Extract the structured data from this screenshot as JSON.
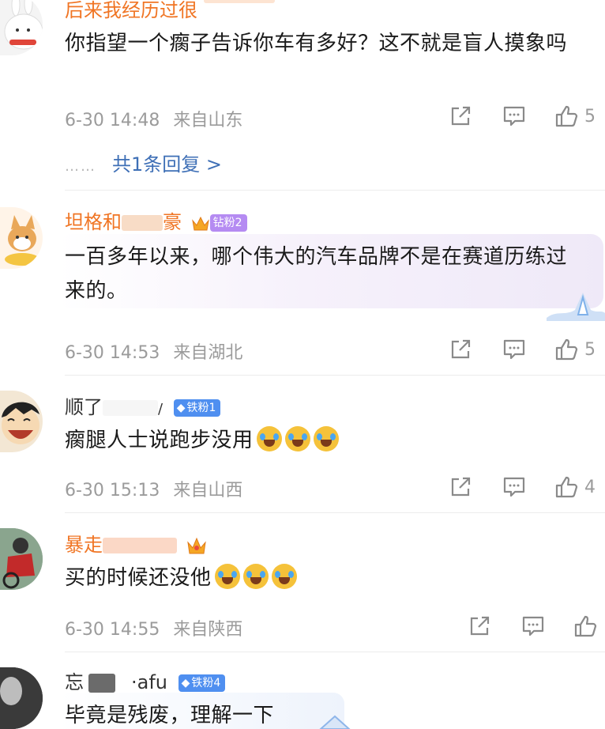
{
  "comments": [
    {
      "name": "后来我经历过很",
      "text": "你指望一个瘸子告诉你车有多好？这不就是盲人摸象吗",
      "date": "6-30 14:48",
      "location": "来自山东",
      "likes": "5",
      "replies": {
        "dots": "……",
        "label": "共1条回复 >"
      }
    },
    {
      "name": "坦格和",
      "name_suffix": "豪",
      "badge": "钻粉2",
      "text": "一百多年以来，哪个伟大的汽车品牌不是在赛道历练过来的。",
      "date": "6-30 14:53",
      "location": "来自湖北",
      "likes": "5"
    },
    {
      "name": "顺了",
      "name_suffix": "/",
      "badge": "铁粉1",
      "text": "瘸腿人士说跑步没用",
      "date": "6-30 15:13",
      "location": "来自山西",
      "likes": "4"
    },
    {
      "name": "暴走",
      "text": "买的时候还没他",
      "date": "6-30 14:55",
      "location": "来自陕西",
      "likes": ""
    },
    {
      "name": "忘",
      "name_suffix": "·afu",
      "badge": "铁粉4",
      "text": "毕竟是残废，理解一下"
    }
  ],
  "icons": {
    "share": "share-icon",
    "comment": "comment-icon",
    "like": "thumbs-up-icon",
    "emoji": "laugh-cry-emoji"
  },
  "colors": {
    "name_orange": "#f07524",
    "link_blue": "#3e6fb6",
    "meta_gray": "#9b9b9b",
    "badge_blue": "#4f8ff0",
    "badge_purple": "#b58bf2"
  }
}
